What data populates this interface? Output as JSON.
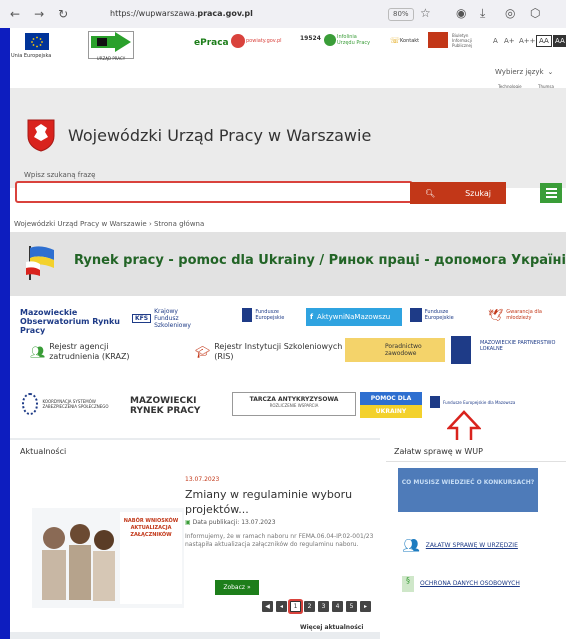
{
  "browser": {
    "url_prefix": "https://wupwarszawa.",
    "url_bold": "praca.gov.pl",
    "zoom": "80%"
  },
  "top": {
    "eu_label": "Unia Europejska",
    "upp_label": "URZĄD PRACY",
    "epraca": "ePraca",
    "powiaty": "powiaty.gov.pl",
    "infolinia_num": "19524",
    "infolinia_text": "Infolinia Urzędu Pracy",
    "kontakt": "Kontakt",
    "bip": "Biuletyn Informacji Publicznej",
    "font_sizes": [
      "A",
      "A+",
      "A++"
    ],
    "contrast": [
      "AA",
      "AA"
    ],
    "lang": "Wybierz język",
    "tech": "Technologie",
    "tech_vendor": "Thumsa"
  },
  "header": {
    "title": "Wojewódzki Urząd Pracy w Warszawie"
  },
  "search": {
    "label": "Wpisz szukaną frazę",
    "button": "Szukaj"
  },
  "breadcrumb": [
    "Wojewódzki Urząd Pracy w Warszawie",
    "Strona główna"
  ],
  "ukraine_banner": "Rynek pracy - pomoc dla Ukrainy / Ринок праці - допомога Україні",
  "partners": [
    "Mazowieckie Obserwatorium Rynku Pracy",
    "Krajowy Fundusz Szkoleniowy",
    "Fundusze Europejskie",
    "AktywniNaMazowszu",
    "Fundusze Europejskie",
    "Gwarancja dla młodzieży",
    "Rejestr agencji zatrudnienia (KRAZ)",
    "Rejestr Instytucji Szkoleniowych (RIS)",
    "Poradnictwo zawodowe",
    "MAZOWIECKIE PARTNERSTWO LOKALNE",
    "KOORDYNACJA SYSTEMÓW ZABEZPIECZENIA SPOŁECZNEGO",
    "MAZOWIECKI RYNEK PRACY",
    "TARCZA ANTYKRYZYSOWA",
    "ROZLICZENIE WSPARCIA",
    "POMOC DLA UKRAINY",
    "Fundusze Europejskie dla Mazowsza"
  ],
  "news": {
    "heading": "Aktualności",
    "date": "13.07.2023",
    "title": "Zmiany w regulaminie wyboru projektów...",
    "pub_label": "Data publikacji: 13.07.2023",
    "desc": "Informujemy, że w ramach naboru nr FEMA.06.04-IP.02-001/23 nastąpiła aktualizacja załączników do regulaminu naboru.",
    "more": "Zobacz »",
    "thumb_text": "NABÓR WNIOSKÓW AKTUALIZACJA ZAŁĄCZNIKÓW",
    "pages": [
      "1",
      "2",
      "3",
      "4",
      "5"
    ],
    "all_link": "Więcej aktualności"
  },
  "side": {
    "heading": "Załatw sprawę w WUP",
    "banner": "CO MUSISZ WIEDZIEĆ O KONKURSACH?",
    "link1": "ZAŁATW SPRAWĘ W URZĘDZIE",
    "link2": "OCHRONA DANYCH OSOBOWYCH"
  },
  "colors": {
    "accent_red": "#c23718",
    "green": "#3a9d38",
    "ukr_green": "#226426",
    "frame_blue": "#0d1dbf"
  }
}
